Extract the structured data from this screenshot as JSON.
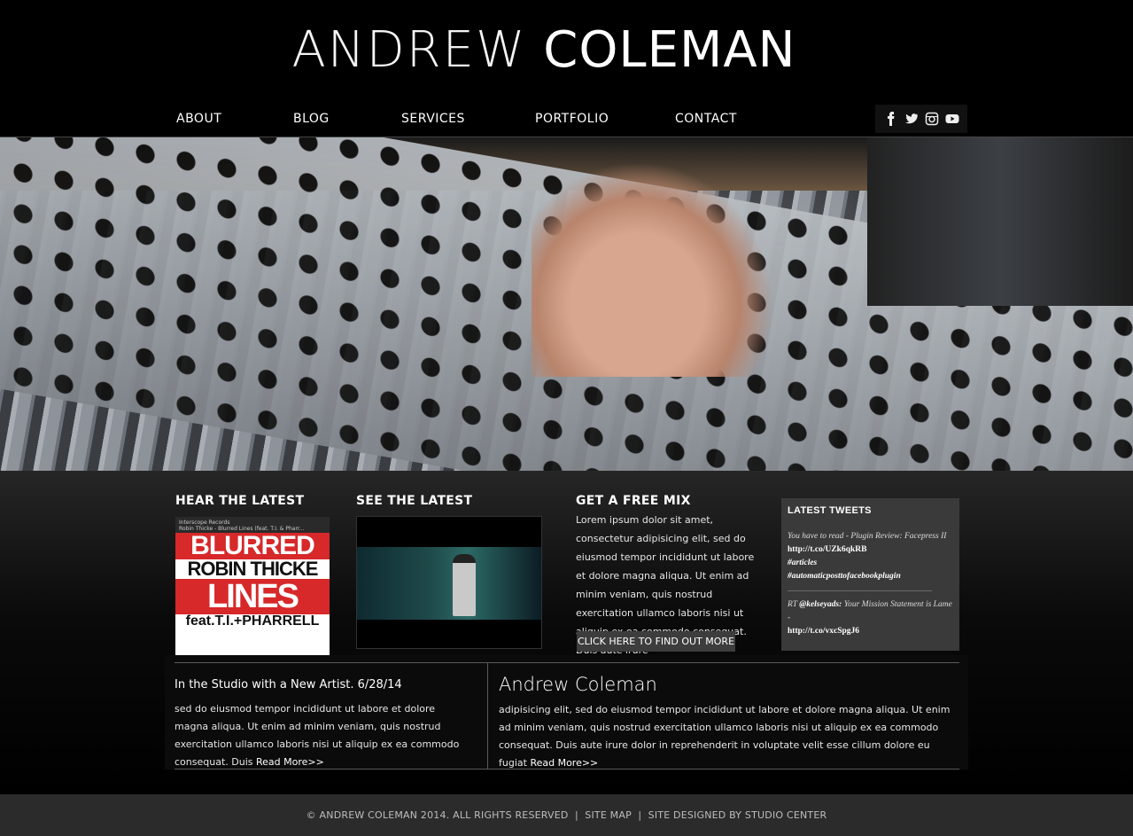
{
  "site": {
    "title_first": "ANDREW",
    "title_last": "COLEMAN"
  },
  "nav": {
    "items": [
      "ABOUT",
      "BLOG",
      "SERVICES",
      "PORTFOLIO",
      "CONTACT"
    ]
  },
  "social": {
    "icons": [
      "facebook-icon",
      "twitter-icon",
      "instagram-icon",
      "youtube-icon"
    ]
  },
  "sections": {
    "hear": {
      "heading": "HEAR THE LATEST",
      "player": {
        "label": "Interscope Records",
        "track": "Robin Thicke - Blurred Lines (feat. T.I. & Pharr...",
        "cover_line1": "BLURRED",
        "cover_line2": "ROBIN THICKE",
        "cover_line3": "LINES",
        "cover_line4": "feat.T.I.+PHARRELL"
      }
    },
    "see": {
      "heading": "SEE THE LATEST"
    },
    "mix": {
      "heading": "GET A FREE MIX",
      "body": "Lorem ipsum dolor sit amet, consectetur adipisicing elit, sed do eiusmod tempor incididunt ut labore et dolore magna aliqua. Ut enim ad minim veniam, quis nostrud exercitation ullamco laboris nisi ut aliquip ex ea commodo consequat. Duis aute irure",
      "button": "CLICK HERE TO FIND OUT MORE >>"
    },
    "tweets": {
      "heading": "LATEST TWEETS",
      "tweet1_text": "You have to read - Plugin Review: Facepress II",
      "tweet1_link": "http://t.co/UZk6qkRB",
      "tweet1_tag1": "#articles",
      "tweet1_tag2": "#automaticposttofacebookplugin",
      "tweet2_prefix": "RT",
      "tweet2_user": "@kelseyads:",
      "tweet2_text": "Your Mission Statement is Lame -",
      "tweet2_link": "http://t.co/vxcSpgJ6"
    }
  },
  "posts": {
    "left": {
      "title": "In the Studio with a New Artist. 6/28/14",
      "body": "sed do eiusmod tempor incididunt ut labore et dolore magna aliqua. Ut enim ad minim veniam, quis nostrud exercitation ullamco laboris nisi ut aliquip ex ea commodo consequat. Duis",
      "read_more": "Read More>>"
    },
    "right": {
      "title": "Andrew Coleman",
      "body": "adipisicing elit, sed do eiusmod tempor incididunt ut labore et dolore magna aliqua. Ut enim ad minim veniam, quis nostrud exercitation ullamco laboris nisi ut aliquip ex ea commodo consequat. Duis aute irure dolor in reprehenderit in voluptate velit esse cillum dolore eu fugiat",
      "read_more": "Read More>>"
    }
  },
  "footer": {
    "copyright": "© ANDREW COLEMAN 2014. ALL RIGHTS RESERVED",
    "divider": "|",
    "site_map": "SITE MAP",
    "credit": "SITE DESIGNED BY STUDIO CENTER"
  }
}
